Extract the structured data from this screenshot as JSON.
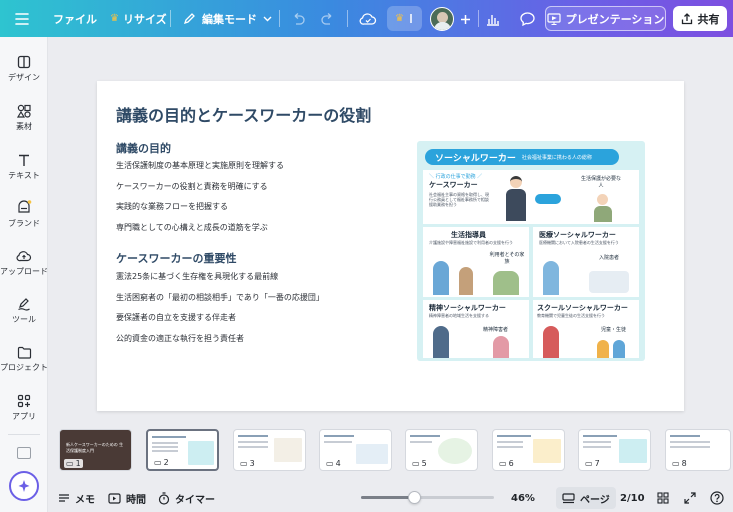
{
  "topbar": {
    "file_label": "ファイル",
    "resize_label": "リサイズ",
    "mode_label": "編集モード",
    "present_label": "プレゼンテーション",
    "share_label": "共有"
  },
  "sidebar": {
    "items": [
      {
        "label": "デザイン",
        "icon": "layout-icon"
      },
      {
        "label": "素材",
        "icon": "shapes-icon"
      },
      {
        "label": "テキスト",
        "icon": "text-icon"
      },
      {
        "label": "ブランド",
        "icon": "brand-icon"
      },
      {
        "label": "アップロード",
        "icon": "cloud-upload-icon"
      },
      {
        "label": "ツール",
        "icon": "pen-icon"
      },
      {
        "label": "プロジェクト",
        "icon": "folder-icon"
      },
      {
        "label": "アプリ",
        "icon": "apps-icon"
      }
    ]
  },
  "slide": {
    "title": "講義の目的とケースワーカーの役割",
    "section1_heading": "講義の目的",
    "section1_items": [
      "生活保護制度の基本原理と実施原則を理解する",
      "ケースワーカーの役割と責務を明確にする",
      "実践的な業務フローを把握する",
      "専門職としての心構えと成長の道筋を学ぶ"
    ],
    "section2_heading": "ケースワーカーの重要性",
    "section2_items": [
      "憲法25条に基づく生存権を具現化する最前線",
      "生活困窮者の「最初の相談相手」であり「一番の応援団」",
      "要保護者の自立を支援する伴走者",
      "公的資金の適正な執行を担う責任者"
    ],
    "illustration": {
      "banner_title": "ソーシャルワーカー",
      "banner_sub": "社会福祉事業に携わる人の総称",
      "panel1_tag": "＼ 行政の仕事で勤務 ／",
      "panel1_title": "ケースワーカー",
      "panel1_desc": "社会福祉主事の資格を取得し、現行公務員として福祉事務所で相談援助業務を担う",
      "panel1_right": "生活保護が必要な人",
      "panel2_title": "生活指導員",
      "panel2_desc": "介護施設や障害福祉施設で利用者の支援を行う",
      "panel2_right": "利用者とその家族",
      "panel3_title": "医療ソーシャルワーカー",
      "panel3_desc": "医療機関において入院患者の生活支援を行う",
      "panel3_right": "入院患者",
      "panel4_title": "精神ソーシャルワーカー",
      "panel4_desc": "精神障害者の地域生活を支援する",
      "panel4_right": "精神障害者",
      "panel5_title": "スクールソーシャルワーカー",
      "panel5_desc": "教育機関で児童生徒の生活支援を行う",
      "panel5_right": "児童・生徒"
    }
  },
  "thumbnails": [
    {
      "num": "1",
      "style": "dark"
    },
    {
      "num": "2",
      "style": "selected"
    },
    {
      "num": "3",
      "style": "plain"
    },
    {
      "num": "4",
      "style": "plain"
    },
    {
      "num": "5",
      "style": "plain"
    },
    {
      "num": "6",
      "style": "plain"
    },
    {
      "num": "7",
      "style": "plain"
    },
    {
      "num": "8",
      "style": "plain"
    }
  ],
  "thumb1_text": "新人ケースワーカーのための 生活保護制度入門",
  "bottombar": {
    "memo_label": "メモ",
    "timer_label": "時間",
    "timer2_label": "タイマー",
    "zoom_label": "46%",
    "zoom_value": 46,
    "page_view_label": "ページ",
    "page_counter": "2/10"
  },
  "colors": {
    "accent": "#6b5fe6",
    "title_color": "#2f4a66",
    "illus_bg": "#d6f1f3",
    "banner": "#2ba3dc"
  }
}
